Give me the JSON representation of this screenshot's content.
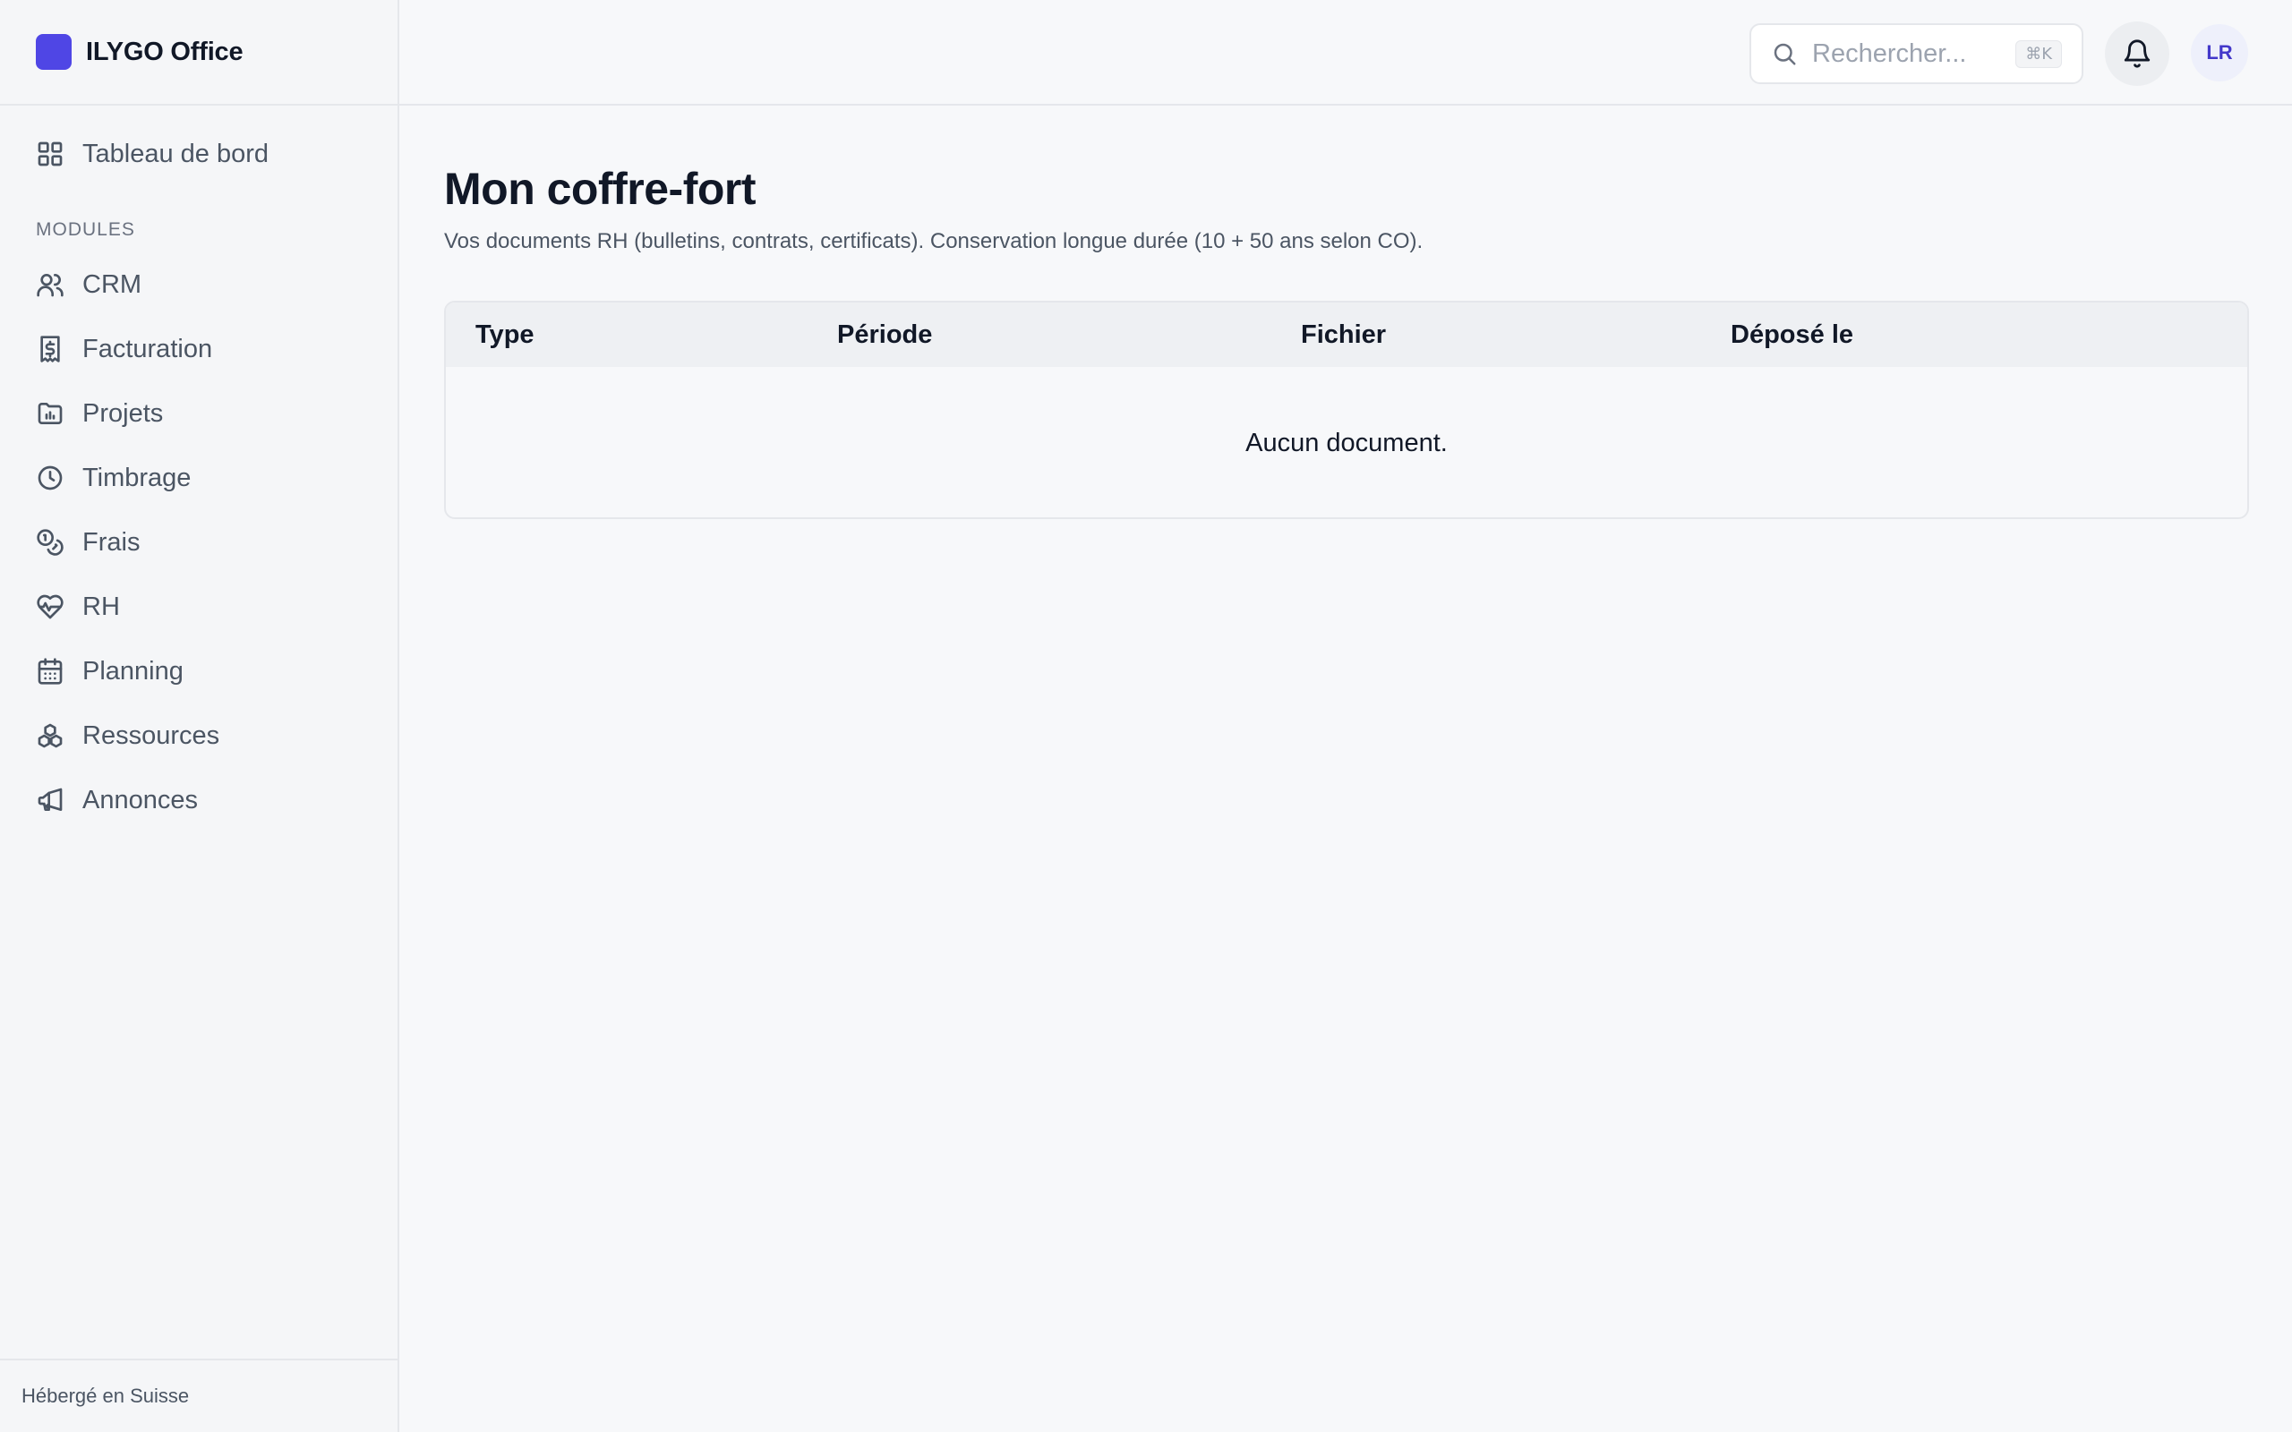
{
  "brand": {
    "name": "ILYGO Office",
    "logo_color": "#4f46e5"
  },
  "sidebar": {
    "dashboard": {
      "label": "Tableau de bord",
      "icon": "grid-icon"
    },
    "section_label": "MODULES",
    "items": [
      {
        "label": "CRM",
        "icon": "users-icon"
      },
      {
        "label": "Facturation",
        "icon": "receipt-dollar-icon"
      },
      {
        "label": "Projets",
        "icon": "folder-chart-icon"
      },
      {
        "label": "Timbrage",
        "icon": "clock-icon"
      },
      {
        "label": "Frais",
        "icon": "coins-icon"
      },
      {
        "label": "RH",
        "icon": "heart-pulse-icon"
      },
      {
        "label": "Planning",
        "icon": "calendar-icon"
      },
      {
        "label": "Ressources",
        "icon": "boxes-icon"
      },
      {
        "label": "Annonces",
        "icon": "megaphone-icon"
      }
    ],
    "footer": "Hébergé en Suisse"
  },
  "topbar": {
    "search": {
      "placeholder": "Rechercher...",
      "shortcut": "⌘K"
    },
    "avatar_initials": "LR"
  },
  "main": {
    "title": "Mon coffre-fort",
    "subtitle": "Vos documents RH (bulletins, contrats, certificats). Conservation longue durée (10 + 50 ans selon CO).",
    "table": {
      "columns": [
        "Type",
        "Période",
        "Fichier",
        "Déposé le"
      ],
      "empty_message": "Aucun document."
    }
  }
}
